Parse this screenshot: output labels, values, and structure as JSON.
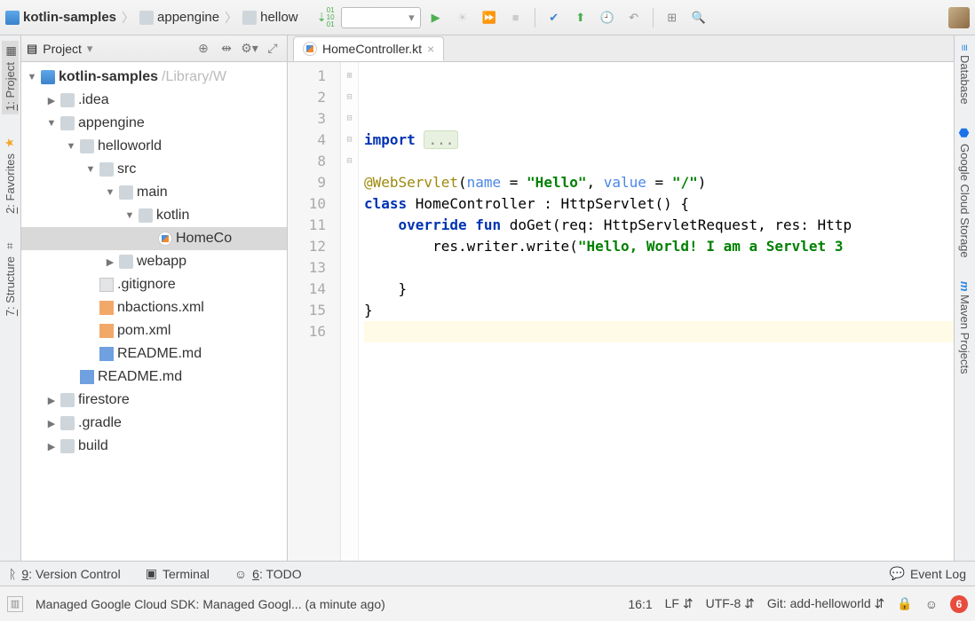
{
  "breadcrumb": [
    {
      "icon": "folder-blue",
      "label": "kotlin-samples"
    },
    {
      "icon": "folder",
      "label": "appengine"
    },
    {
      "icon": "folder",
      "label": "hellow"
    }
  ],
  "left_tabs": [
    {
      "label": "1: Project",
      "icon": "▦",
      "active": true
    },
    {
      "label": "2: Favorites",
      "icon": "★"
    },
    {
      "label": "7: Structure",
      "icon": "⌗"
    }
  ],
  "right_tabs": [
    {
      "label": "Database",
      "icon": "≡",
      "color": "#2e86de"
    },
    {
      "label": "Google Cloud Storage",
      "icon": "⬣",
      "color": "#1a73e8"
    },
    {
      "label": "Maven Projects",
      "icon": "m",
      "color": "#2e86de",
      "italic": true
    }
  ],
  "project_header": {
    "title": "Project"
  },
  "tree": [
    {
      "indent": 0,
      "twisty": "▼",
      "icon": "folder-blue",
      "label": "kotlin-samples",
      "suffix": " /Library/W",
      "bold": true
    },
    {
      "indent": 1,
      "twisty": "▶",
      "icon": "folder",
      "label": ".idea"
    },
    {
      "indent": 1,
      "twisty": "▼",
      "icon": "folder",
      "label": "appengine"
    },
    {
      "indent": 2,
      "twisty": "▼",
      "icon": "folder",
      "label": "helloworld"
    },
    {
      "indent": 3,
      "twisty": "▼",
      "icon": "folder",
      "label": "src"
    },
    {
      "indent": 4,
      "twisty": "▼",
      "icon": "folder",
      "label": "main"
    },
    {
      "indent": 5,
      "twisty": "▼",
      "icon": "folder",
      "label": "kotlin"
    },
    {
      "indent": 6,
      "twisty": "",
      "icon": "kt",
      "label": "HomeCo",
      "selected": true
    },
    {
      "indent": 4,
      "twisty": "▶",
      "icon": "folder",
      "label": "webapp"
    },
    {
      "indent": 3,
      "twisty": "",
      "icon": "file",
      "label": ".gitignore"
    },
    {
      "indent": 3,
      "twisty": "",
      "icon": "xml",
      "label": "nbactions.xml"
    },
    {
      "indent": 3,
      "twisty": "",
      "icon": "xml",
      "label": "pom.xml"
    },
    {
      "indent": 3,
      "twisty": "",
      "icon": "md",
      "label": "README.md"
    },
    {
      "indent": 2,
      "twisty": "",
      "icon": "md",
      "label": "README.md"
    },
    {
      "indent": 1,
      "twisty": "▶",
      "icon": "folder",
      "label": "firestore"
    },
    {
      "indent": 1,
      "twisty": "▶",
      "icon": "folder",
      "label": ".gradle"
    },
    {
      "indent": 1,
      "twisty": "▶",
      "icon": "folder",
      "label": "build"
    }
  ],
  "editor_tab": {
    "label": "HomeController.kt"
  },
  "gutter_lines": [
    "1",
    "2",
    "3",
    "4",
    "8",
    "9",
    "10",
    "11",
    "12",
    "13",
    "14",
    "15",
    "16"
  ],
  "fold_marks": [
    "",
    "",
    "",
    "⊞",
    "",
    "",
    "⊟",
    "⊟",
    "",
    "",
    "⊟",
    "⊟",
    ""
  ],
  "code_lines": [
    {
      "segs": []
    },
    {
      "segs": []
    },
    {
      "segs": []
    },
    {
      "segs": [
        {
          "t": "import ",
          "c": "kw"
        },
        {
          "t": "...",
          "c": "fold-dots"
        }
      ]
    },
    {
      "segs": []
    },
    {
      "segs": [
        {
          "t": "@WebServlet",
          "c": "ann"
        },
        {
          "t": "("
        },
        {
          "t": "name",
          "c": "param"
        },
        {
          "t": " = "
        },
        {
          "t": "\"Hello\"",
          "c": "str"
        },
        {
          "t": ", "
        },
        {
          "t": "value",
          "c": "param"
        },
        {
          "t": " = "
        },
        {
          "t": "\"/\"",
          "c": "str"
        },
        {
          "t": ")"
        }
      ]
    },
    {
      "segs": [
        {
          "t": "class ",
          "c": "kw"
        },
        {
          "t": "HomeController : HttpServlet() {",
          "c": "cls"
        }
      ]
    },
    {
      "segs": [
        {
          "t": "    "
        },
        {
          "t": "override fun ",
          "c": "kw"
        },
        {
          "t": "doGet(req: HttpServletRequest, res: Http"
        }
      ]
    },
    {
      "segs": [
        {
          "t": "        res.writer.write("
        },
        {
          "t": "\"Hello, World! I am a Servlet 3",
          "c": "str"
        }
      ]
    },
    {
      "segs": []
    },
    {
      "segs": [
        {
          "t": "    }"
        }
      ]
    },
    {
      "segs": [
        {
          "t": "}"
        }
      ]
    },
    {
      "segs": [],
      "current": true
    }
  ],
  "bottom_tools": [
    {
      "icon": "ᚱ",
      "label": "9: Version Control",
      "key": "9"
    },
    {
      "icon": "▣",
      "label": "Terminal"
    },
    {
      "icon": "☺",
      "label": "6: TODO",
      "key": "6"
    }
  ],
  "event_log": {
    "label": "Event Log"
  },
  "status": {
    "message": "Managed Google Cloud SDK: Managed Googl... (a minute ago)",
    "caret": "16:1",
    "line_sep": "LF",
    "encoding": "UTF-8",
    "git": "Git: add-helloworld",
    "warnings": "6"
  }
}
